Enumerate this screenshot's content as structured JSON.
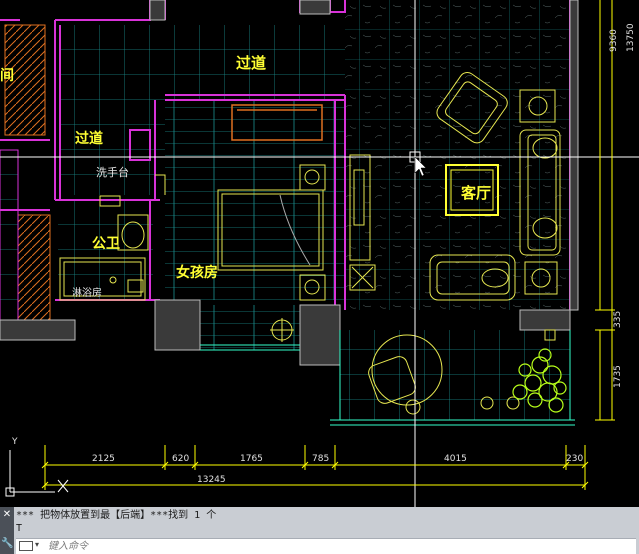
{
  "rooms": {
    "corridor_top": "过道",
    "corridor_left": "过道",
    "living_room": "客厅",
    "washbasin": "洗手台",
    "bathroom": "公卫",
    "shower": "淋浴房",
    "girls_room": "女孩房",
    "partial_left": "间"
  },
  "dimensions": {
    "bottom_segments": [
      "2125",
      "620",
      "1765",
      "785",
      "4015",
      "230"
    ],
    "bottom_total": "13245",
    "right": [
      "9360",
      "13750",
      "335",
      "1735"
    ]
  },
  "ucs": {
    "x": "X",
    "y": "Y"
  },
  "command_line": {
    "history_line1": "***  把物体放置到最【后端】***找到 1 个",
    "history_line2": "T",
    "input_placeholder": "键入命令",
    "close_glyph": "✕",
    "settings_glyph": "🔧"
  },
  "colors": {
    "wall": "#d932d9",
    "tile_grid": "#1fa3a3",
    "furniture": "#e6e650",
    "room_label": "#ffff33",
    "dimension": "#ffff00",
    "plant": "#b8ff1a",
    "background": "#000000",
    "command_bg": "#c9cdd3"
  }
}
